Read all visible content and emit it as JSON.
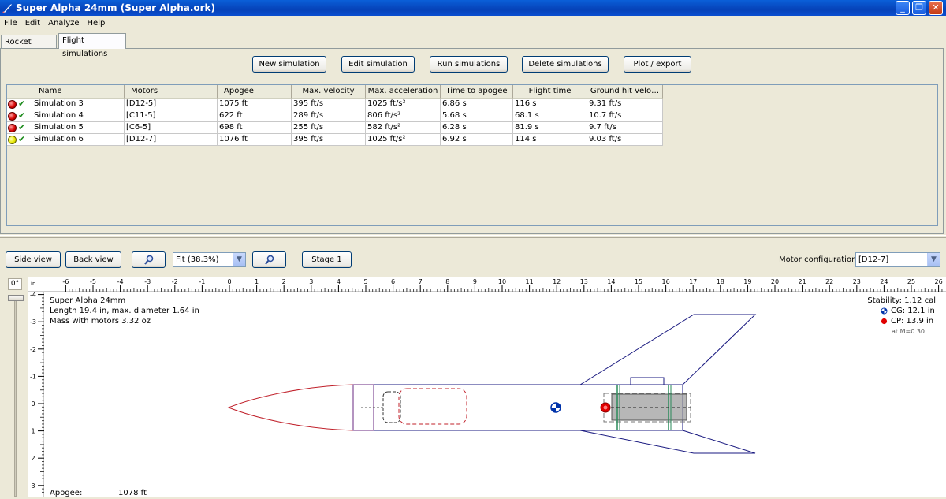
{
  "window": {
    "title": "Super Alpha 24mm (Super Alpha.ork)",
    "minimize": "_",
    "restore": "❐",
    "close": "✕"
  },
  "menu": [
    "File",
    "Edit",
    "Analyze",
    "Help"
  ],
  "tabs": [
    {
      "label": "Rocket design",
      "active": false
    },
    {
      "label": "Flight simulations",
      "active": true
    }
  ],
  "toolbar": {
    "new": "New simulation",
    "edit": "Edit simulation",
    "run": "Run simulations",
    "delete": "Delete simulations",
    "plot": "Plot / export"
  },
  "table": {
    "columns": [
      "Name",
      "Motors",
      "Apogee",
      "Max. velocity",
      "Max. acceleration",
      "Time to apogee",
      "Flight time",
      "Ground hit velo…"
    ],
    "rows": [
      {
        "status": "red",
        "name": "Simulation 3",
        "motors": "[D12-5]",
        "apogee": "1075 ft",
        "vel": "395 ft/s",
        "acc": "1025 ft/s²",
        "tta": "6.86 s",
        "ft": "116 s",
        "ghv": "9.31 ft/s"
      },
      {
        "status": "red",
        "name": "Simulation 4",
        "motors": "[C11-5]",
        "apogee": "622 ft",
        "vel": "289 ft/s",
        "acc": "806 ft/s²",
        "tta": "5.68 s",
        "ft": "68.1 s",
        "ghv": "10.7 ft/s"
      },
      {
        "status": "red",
        "name": "Simulation 5",
        "motors": "[C6-5]",
        "apogee": "698 ft",
        "vel": "255 ft/s",
        "acc": "582 ft/s²",
        "tta": "6.28 s",
        "ft": "81.9 s",
        "ghv": "9.7 ft/s"
      },
      {
        "status": "yellow",
        "name": "Simulation 6",
        "motors": "[D12-7]",
        "apogee": "1076 ft",
        "vel": "395 ft/s",
        "acc": "1025 ft/s²",
        "tta": "6.92 s",
        "ft": "114 s",
        "ghv": "9.03 ft/s"
      }
    ]
  },
  "view": {
    "side_view": "Side view",
    "back_view": "Back view",
    "zoom": "Fit (38.3%)",
    "stage": "Stage 1",
    "motor_config_label": "Motor configuration:",
    "motor_config_value": "[D12-7]",
    "rotation": "0°",
    "ruler_unit": "in"
  },
  "rocket_info": {
    "name": "Super Alpha 24mm",
    "length": "Length 19.4 in, max. diameter 1.64 in",
    "mass": "Mass with motors 3.32 oz",
    "apogee_label": "Apogee:",
    "apogee_value": "1078 ft"
  },
  "stability": {
    "stability": "Stability: 1.12 cal",
    "cg": "CG:  12.1 in",
    "cp": "CP:  13.9 in",
    "mach": "at M=0.30"
  },
  "colors": {
    "accent": "#0a4ed0",
    "cp_red": "#e00000",
    "cg_blue": "#0033aa"
  }
}
